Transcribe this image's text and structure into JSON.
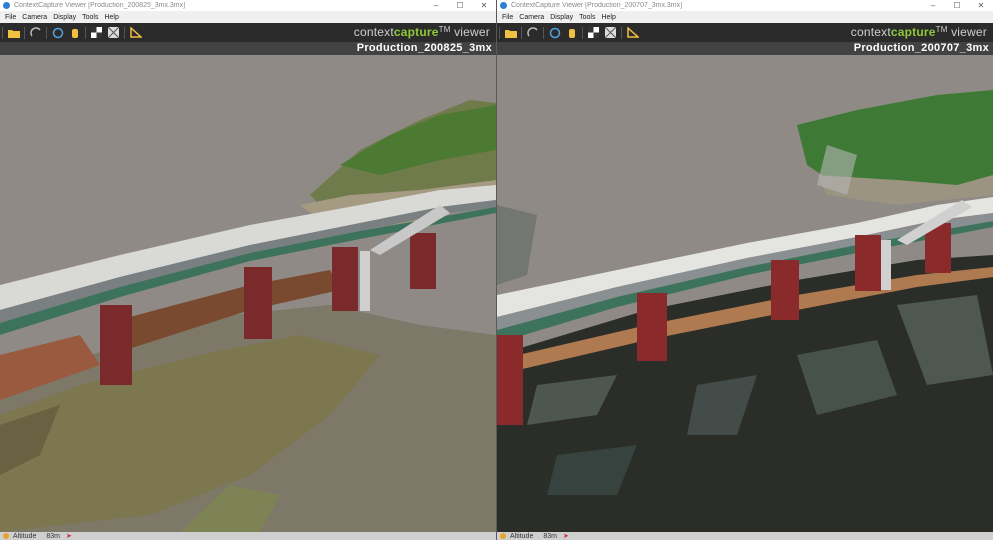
{
  "windows": [
    {
      "title": "ContextCapture Viewer [Production_200825_3mx.3mx]",
      "project": "Production_200825_3mx",
      "status": {
        "label": "Altitude",
        "value": "83m"
      }
    },
    {
      "title": "ContextCapture Viewer [Production_200707_3mx.3mx]",
      "project": "Production_200707_3mx",
      "status": {
        "label": "Altitude",
        "value": "83m"
      }
    }
  ],
  "menu": [
    "File",
    "Camera",
    "Display",
    "Tools",
    "Help"
  ],
  "brand": {
    "prefix": "context",
    "highlight": "capture",
    "suffix": " viewer",
    "mark": "TM"
  },
  "window_controls": {
    "minimize": "–",
    "maximize": "☐",
    "close": "✕"
  },
  "toolbar_icons": [
    "open-folder-icon",
    "orbit-icon",
    "pan-mode-icon",
    "hand-icon",
    "checker-icon",
    "wireframe-icon",
    "ruler-triangle-icon"
  ],
  "colors": {
    "accent": "#8fc93a",
    "background": "#8f8a86",
    "toolbar": "#2b2b2b"
  }
}
